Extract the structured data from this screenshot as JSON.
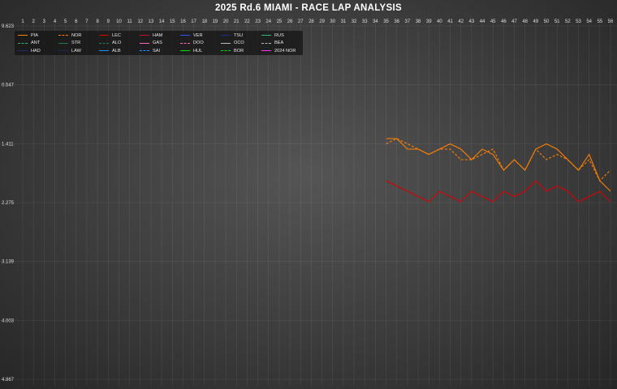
{
  "title": "2025 Rd.6 MIAMI - RACE LAP ANALYSIS",
  "chart_data": {
    "type": "line",
    "title": "2025 Rd.6 MIAMI - RACE LAP ANALYSIS",
    "xlabel": "",
    "ylabel": "",
    "x_ticks": [
      1,
      2,
      3,
      4,
      5,
      6,
      7,
      8,
      9,
      10,
      11,
      12,
      13,
      14,
      15,
      16,
      17,
      18,
      19,
      20,
      21,
      22,
      23,
      24,
      25,
      26,
      27,
      28,
      29,
      30,
      31,
      32,
      33,
      34,
      35,
      36,
      37,
      38,
      39,
      40,
      41,
      42,
      43,
      44,
      45,
      46,
      47,
      48,
      49,
      50,
      51,
      52,
      53,
      54,
      55,
      56
    ],
    "y_tick_labels": [
      "9.623",
      "0.547",
      "1.411",
      "2.275",
      "3.139",
      "4.003",
      "4.867"
    ],
    "grid": true,
    "legend_position": "top-left",
    "series": [
      {
        "name": "PIA",
        "color": "#ff8000",
        "dash": "solid",
        "values": [
          null,
          null,
          null,
          null,
          null,
          null,
          null,
          null,
          null,
          null,
          null,
          null,
          null,
          null,
          null,
          null,
          null,
          null,
          null,
          null,
          null,
          null,
          null,
          null,
          null,
          null,
          null,
          null,
          null,
          null,
          null,
          null,
          null,
          null,
          0.8,
          0.8,
          0.9,
          0.9,
          0.95,
          0.9,
          0.85,
          0.9,
          1.0,
          0.9,
          0.95,
          1.1,
          1.0,
          1.1,
          0.9,
          0.85,
          0.9,
          1.0,
          1.1,
          0.95,
          1.2,
          1.3
        ]
      },
      {
        "name": "NOR",
        "color": "#ff8000",
        "dash": "dash",
        "values": [
          null,
          null,
          null,
          null,
          null,
          null,
          null,
          null,
          null,
          null,
          null,
          null,
          null,
          null,
          null,
          null,
          null,
          null,
          null,
          null,
          null,
          null,
          null,
          null,
          null,
          null,
          null,
          null,
          null,
          null,
          null,
          null,
          null,
          null,
          0.85,
          0.8,
          0.85,
          0.9,
          0.95,
          0.9,
          0.9,
          1.0,
          1.0,
          0.95,
          0.9,
          1.1,
          1.0,
          1.1,
          0.9,
          1.0,
          0.95,
          1.0,
          1.1,
          1.0,
          1.2,
          1.1
        ]
      },
      {
        "name": "LEC",
        "color": "#dc0000",
        "dash": "solid",
        "values": [
          null,
          null,
          null,
          null,
          null,
          null,
          null,
          null,
          null,
          null,
          null,
          null,
          null,
          null,
          null,
          null,
          null,
          null,
          null,
          null,
          null,
          null,
          null,
          null,
          null,
          null,
          null,
          null,
          null,
          null,
          null,
          null,
          null,
          null,
          1.2,
          1.25,
          1.3,
          1.35,
          1.4,
          1.3,
          1.35,
          1.4,
          1.3,
          1.35,
          1.4,
          1.3,
          1.35,
          1.3,
          1.2,
          1.3,
          1.25,
          1.3,
          1.4,
          1.35,
          1.3,
          1.4
        ]
      },
      {
        "name": "HAM",
        "color": "#c8102e",
        "dash": "solid",
        "values": []
      },
      {
        "name": "VER",
        "color": "#3050ff",
        "dash": "solid",
        "values": []
      },
      {
        "name": "TSU",
        "color": "#203080",
        "dash": "solid",
        "values": []
      },
      {
        "name": "RUS",
        "color": "#2eb86d",
        "dash": "solid",
        "values": []
      },
      {
        "name": "ANT",
        "color": "#2eb86d",
        "dash": "dash",
        "values": []
      },
      {
        "name": "STR",
        "color": "#227a4a",
        "dash": "solid",
        "values": []
      },
      {
        "name": "ALO",
        "color": "#227a4a",
        "dash": "dash",
        "values": []
      },
      {
        "name": "GAS",
        "color": "#ff66c4",
        "dash": "solid",
        "values": []
      },
      {
        "name": "DOO",
        "color": "#ff66c4",
        "dash": "dash",
        "values": []
      },
      {
        "name": "OCO",
        "color": "#bbbbbb",
        "dash": "solid",
        "values": []
      },
      {
        "name": "BEA",
        "color": "#bbbbbb",
        "dash": "dash",
        "values": []
      },
      {
        "name": "HAD",
        "color": "#1c2c6c",
        "dash": "solid",
        "values": []
      },
      {
        "name": "LAW",
        "color": "#1c2c6c",
        "dash": "dash",
        "values": []
      },
      {
        "name": "ALB",
        "color": "#1e90ff",
        "dash": "solid",
        "values": []
      },
      {
        "name": "SAI",
        "color": "#1e90ff",
        "dash": "dash",
        "values": []
      },
      {
        "name": "HUL",
        "color": "#00e000",
        "dash": "solid",
        "values": []
      },
      {
        "name": "BOR",
        "color": "#00e000",
        "dash": "dash",
        "values": []
      },
      {
        "name": "2024 NOR",
        "color": "#ff33ff",
        "dash": "solid",
        "values": []
      }
    ]
  }
}
